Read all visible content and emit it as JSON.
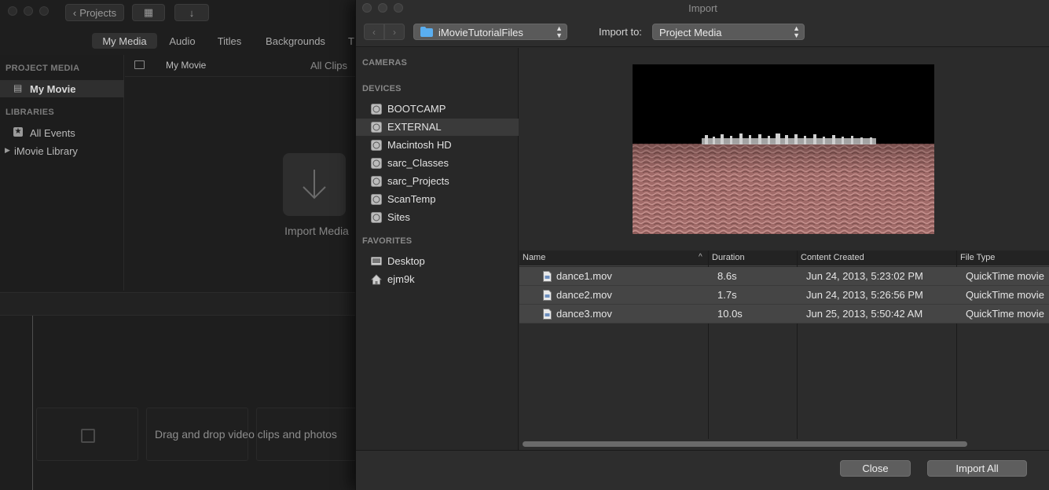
{
  "imovie": {
    "toolbar": {
      "projects_label": "Projects"
    },
    "tabs": [
      {
        "label": "My Media",
        "active": true
      },
      {
        "label": "Audio",
        "active": false
      },
      {
        "label": "Titles",
        "active": false
      },
      {
        "label": "Backgrounds",
        "active": false
      },
      {
        "label": "T",
        "active": false
      }
    ],
    "library": {
      "project_media_heading": "PROJECT MEDIA",
      "project_item": "My Movie",
      "libraries_heading": "LIBRARIES",
      "all_events": "All Events",
      "imovie_library": "iMovie Library"
    },
    "browser": {
      "title": "My Movie",
      "filter": "All Clips",
      "import_label": "Import Media"
    },
    "timeline": {
      "drag_hint": "Drag and drop video clips and photos"
    }
  },
  "dialog": {
    "title": "Import",
    "location_popup": "iMovieTutorialFiles",
    "import_to_label": "Import to:",
    "import_to_popup": "Project Media",
    "sidebar": {
      "cameras_heading": "CAMERAS",
      "devices_heading": "DEVICES",
      "devices": [
        "BOOTCAMP",
        "EXTERNAL",
        "Macintosh HD",
        "sarc_Classes",
        "sarc_Projects",
        "ScanTemp",
        "Sites"
      ],
      "selected_device": "EXTERNAL",
      "favorites_heading": "FAVORITES",
      "favorites": [
        {
          "label": "Desktop",
          "icon": "desktop-icon"
        },
        {
          "label": "ejm9k",
          "icon": "home-icon"
        }
      ]
    },
    "table": {
      "columns": [
        "Name",
        "Duration",
        "Content Created",
        "File Type"
      ],
      "sort_column": "Name",
      "rows": [
        {
          "name": "dance1.mov",
          "duration": "8.6s",
          "created": "Jun 24, 2013, 5:23:02 PM",
          "type": "QuickTime movie"
        },
        {
          "name": "dance2.mov",
          "duration": "1.7s",
          "created": "Jun 24, 2013, 5:26:56 PM",
          "type": "QuickTime movie"
        },
        {
          "name": "dance3.mov",
          "duration": "10.0s",
          "created": "Jun 25, 2013, 5:50:42 AM",
          "type": "QuickTime movie"
        }
      ]
    },
    "buttons": {
      "close": "Close",
      "import_all": "Import All"
    }
  },
  "colors": {
    "selection": "#3a3a3a",
    "row_selected": "#454545",
    "folder_blue": "#5aaef0"
  }
}
